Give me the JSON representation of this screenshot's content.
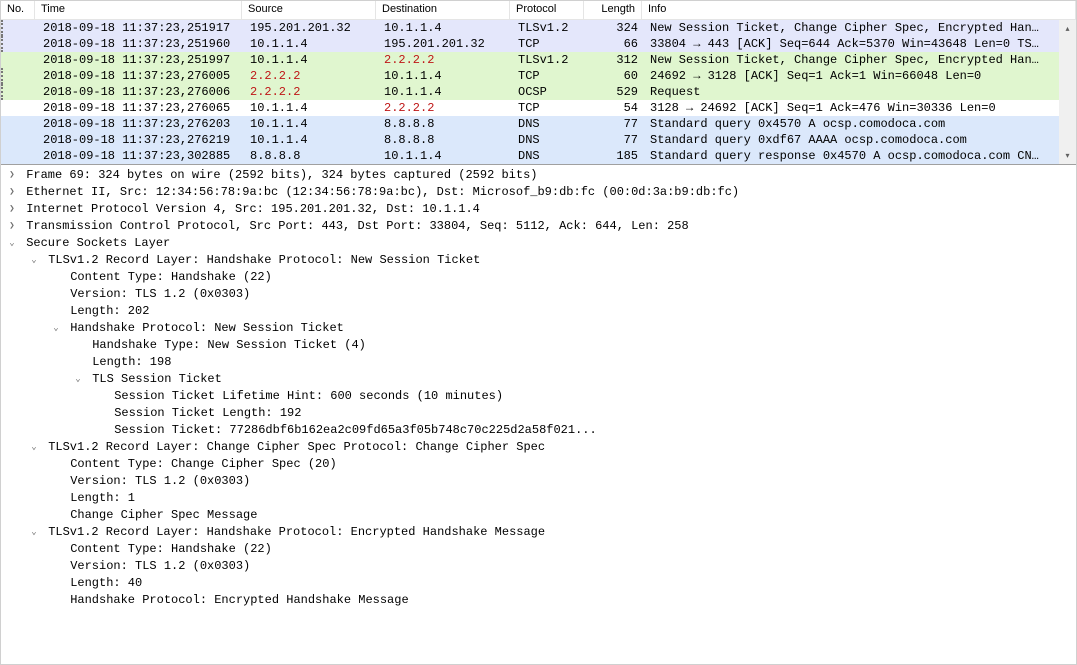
{
  "columns": {
    "no": "No.",
    "time": "Time",
    "src": "Source",
    "dst": "Destination",
    "proto": "Protocol",
    "len": "Length",
    "info": "Info"
  },
  "packets": [
    {
      "bg": "lavender",
      "no": "",
      "time": "2018-09-18 11:37:23,251917",
      "src": "195.201.201.32",
      "dst": "10.1.1.4",
      "proto": "TLSv1.2",
      "len": "324",
      "info": "New Session Ticket, Change Cipher Spec, Encrypted Han…",
      "srcRed": false,
      "dstRed": false
    },
    {
      "bg": "lavender",
      "no": "",
      "time": "2018-09-18 11:37:23,251960",
      "src": "10.1.1.4",
      "dst": "195.201.201.32",
      "proto": "TCP",
      "len": "66",
      "info": "33804 → 443 [ACK] Seq=644 Ack=5370 Win=43648 Len=0 TS…",
      "srcRed": false,
      "dstRed": false
    },
    {
      "bg": "green",
      "no": "",
      "time": "2018-09-18 11:37:23,251997",
      "src": "10.1.1.4",
      "dst": "2.2.2.2",
      "proto": "TLSv1.2",
      "len": "312",
      "info": "New Session Ticket, Change Cipher Spec, Encrypted Han…",
      "srcRed": false,
      "dstRed": true
    },
    {
      "bg": "greendot",
      "no": "",
      "time": "2018-09-18 11:37:23,276005",
      "src": "2.2.2.2",
      "dst": "10.1.1.4",
      "proto": "TCP",
      "len": "60",
      "info": "24692 → 3128 [ACK] Seq=1 Ack=1 Win=66048 Len=0",
      "srcRed": true,
      "dstRed": false
    },
    {
      "bg": "greendot",
      "no": "",
      "time": "2018-09-18 11:37:23,276006",
      "src": "2.2.2.2",
      "dst": "10.1.1.4",
      "proto": "OCSP",
      "len": "529",
      "info": "Request",
      "srcRed": true,
      "dstRed": false
    },
    {
      "bg": "white",
      "no": "",
      "time": "2018-09-18 11:37:23,276065",
      "src": "10.1.1.4",
      "dst": "2.2.2.2",
      "proto": "TCP",
      "len": "54",
      "info": "3128 → 24692 [ACK] Seq=1 Ack=476 Win=30336 Len=0",
      "srcRed": false,
      "dstRed": true
    },
    {
      "bg": "blue",
      "no": "",
      "time": "2018-09-18 11:37:23,276203",
      "src": "10.1.1.4",
      "dst": "8.8.8.8",
      "proto": "DNS",
      "len": "77",
      "info": "Standard query 0x4570 A ocsp.comodoca.com",
      "srcRed": false,
      "dstRed": false
    },
    {
      "bg": "blue",
      "no": "",
      "time": "2018-09-18 11:37:23,276219",
      "src": "10.1.1.4",
      "dst": "8.8.8.8",
      "proto": "DNS",
      "len": "77",
      "info": "Standard query 0xdf67 AAAA ocsp.comodoca.com",
      "srcRed": false,
      "dstRed": false
    },
    {
      "bg": "blue",
      "no": "",
      "time": "2018-09-18 11:37:23,302885",
      "src": "8.8.8.8",
      "dst": "10.1.1.4",
      "proto": "DNS",
      "len": "185",
      "info": "Standard query response 0x4570 A ocsp.comodoca.com CN…",
      "srcRed": false,
      "dstRed": false
    }
  ],
  "tree": [
    {
      "d": 0,
      "e": ">",
      "t": "Frame 69: 324 bytes on wire (2592 bits), 324 bytes captured (2592 bits)"
    },
    {
      "d": 0,
      "e": ">",
      "t": "Ethernet II, Src: 12:34:56:78:9a:bc (12:34:56:78:9a:bc), Dst: Microsof_b9:db:fc (00:0d:3a:b9:db:fc)"
    },
    {
      "d": 0,
      "e": ">",
      "t": "Internet Protocol Version 4, Src: 195.201.201.32, Dst: 10.1.1.4"
    },
    {
      "d": 0,
      "e": ">",
      "t": "Transmission Control Protocol, Src Port: 443, Dst Port: 33804, Seq: 5112, Ack: 644, Len: 258"
    },
    {
      "d": 0,
      "e": "v",
      "t": "Secure Sockets Layer"
    },
    {
      "d": 1,
      "e": "v",
      "t": "TLSv1.2 Record Layer: Handshake Protocol: New Session Ticket"
    },
    {
      "d": 2,
      "e": " ",
      "t": "Content Type: Handshake (22)"
    },
    {
      "d": 2,
      "e": " ",
      "t": "Version: TLS 1.2 (0x0303)"
    },
    {
      "d": 2,
      "e": " ",
      "t": "Length: 202"
    },
    {
      "d": 2,
      "e": "v",
      "t": "Handshake Protocol: New Session Ticket"
    },
    {
      "d": 3,
      "e": " ",
      "t": "Handshake Type: New Session Ticket (4)"
    },
    {
      "d": 3,
      "e": " ",
      "t": "Length: 198"
    },
    {
      "d": 3,
      "e": "v",
      "t": "TLS Session Ticket"
    },
    {
      "d": 4,
      "e": " ",
      "t": "Session Ticket Lifetime Hint: 600 seconds (10 minutes)"
    },
    {
      "d": 4,
      "e": " ",
      "t": "Session Ticket Length: 192"
    },
    {
      "d": 4,
      "e": " ",
      "t": "Session Ticket: 77286dbf6b162ea2c09fd65a3f05b748c70c225d2a58f021..."
    },
    {
      "d": 1,
      "e": "v",
      "t": "TLSv1.2 Record Layer: Change Cipher Spec Protocol: Change Cipher Spec"
    },
    {
      "d": 2,
      "e": " ",
      "t": "Content Type: Change Cipher Spec (20)"
    },
    {
      "d": 2,
      "e": " ",
      "t": "Version: TLS 1.2 (0x0303)"
    },
    {
      "d": 2,
      "e": " ",
      "t": "Length: 1"
    },
    {
      "d": 2,
      "e": " ",
      "t": "Change Cipher Spec Message"
    },
    {
      "d": 1,
      "e": "v",
      "t": "TLSv1.2 Record Layer: Handshake Protocol: Encrypted Handshake Message"
    },
    {
      "d": 2,
      "e": " ",
      "t": "Content Type: Handshake (22)"
    },
    {
      "d": 2,
      "e": " ",
      "t": "Version: TLS 1.2 (0x0303)"
    },
    {
      "d": 2,
      "e": " ",
      "t": "Length: 40"
    },
    {
      "d": 2,
      "e": " ",
      "t": "Handshake Protocol: Encrypted Handshake Message"
    }
  ]
}
